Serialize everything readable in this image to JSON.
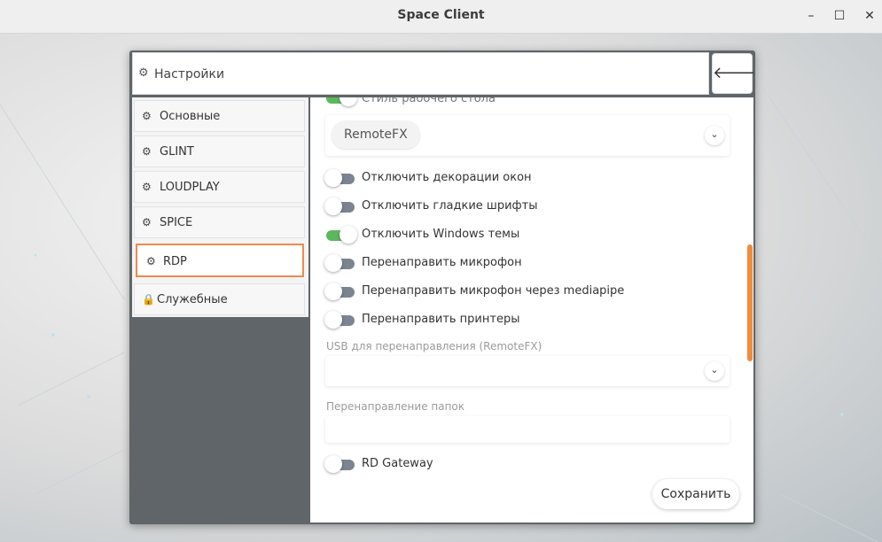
{
  "window": {
    "title": "Space Client",
    "minimize": "✕",
    "maximize": "☐",
    "close": "✕"
  },
  "header": {
    "icon": "gear-icon",
    "title": "Настройки",
    "back_icon": "arrow-left-icon"
  },
  "sidebar": {
    "items": [
      {
        "label": "Основные",
        "icon": "gear-icon",
        "active": false
      },
      {
        "label": "GLINT",
        "icon": "gear-icon",
        "active": false
      },
      {
        "label": "LOUDPLAY",
        "icon": "gear-icon",
        "active": false
      },
      {
        "label": "SPICE",
        "icon": "gear-icon",
        "active": false
      },
      {
        "label": "RDP",
        "icon": "gear-icon",
        "active": true
      },
      {
        "label": "Служебные",
        "icon": "lock-icon",
        "active": false
      }
    ]
  },
  "content": {
    "cut_toggle_label": "Стиль рабочего стола",
    "codec_select": {
      "value": "RemoteFX"
    },
    "toggles": [
      {
        "label": "Отключить декорации окон",
        "on": false
      },
      {
        "label": "Отключить гладкие шрифты",
        "on": false
      },
      {
        "label": "Отключить Windows темы",
        "on": true
      },
      {
        "label": "Перенаправить микрофон",
        "on": false
      },
      {
        "label": "Перенаправить микрофон через mediapipe",
        "on": false
      },
      {
        "label": "Перенаправить принтеры",
        "on": false
      }
    ],
    "usb_label": "USB для перенаправления (RemoteFX)",
    "usb_value": "",
    "folders_label": "Перенаправление папок",
    "folders_value": "",
    "gateway": {
      "label": "RD Gateway",
      "on": false
    },
    "save_label": "Сохранить"
  },
  "colors": {
    "accent": "#f0894d",
    "toggle_on": "#5cb85c",
    "toggle_off": "#7b8591",
    "dialog_bg": "#5f6568"
  }
}
